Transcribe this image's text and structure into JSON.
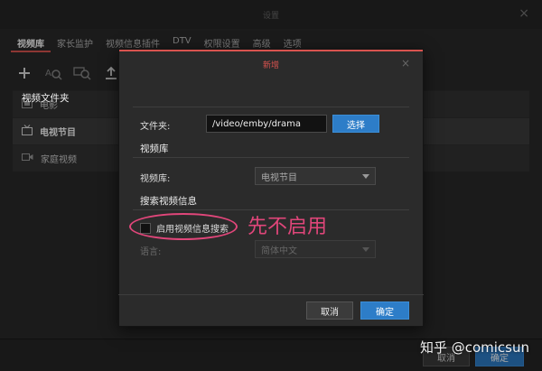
{
  "window": {
    "title": "设置",
    "close": "×"
  },
  "tabs": [
    {
      "label": "视频库",
      "active": true
    },
    {
      "label": "家长监护"
    },
    {
      "label": "视频信息插件"
    },
    {
      "label": "DTV"
    },
    {
      "label": "权限设置"
    },
    {
      "label": "高级"
    },
    {
      "label": "选项"
    }
  ],
  "toolbar": {
    "icons": [
      "add-icon",
      "metadata-search-icon",
      "subtitle-search-icon",
      "upload-icon"
    ]
  },
  "libraries": [
    {
      "label": "电影",
      "icon": "film-icon"
    },
    {
      "label": "电视节目",
      "icon": "tv-icon",
      "selected": true
    },
    {
      "label": "家庭视频",
      "icon": "video-camera-icon"
    }
  ],
  "outer_footer": {
    "cancel_label": "取消",
    "ok_label": "确定"
  },
  "dialog": {
    "title": "新增",
    "close": "×",
    "folder_section": "视频文件夹",
    "folder_label": "文件夹:",
    "folder_value": "/video/emby/drama",
    "browse_label": "选择",
    "library_section": "视频库",
    "library_label": "视频库:",
    "library_value": "电视节目",
    "search_section": "搜索视频信息",
    "enable_search_label": "启用视频信息搜索",
    "language_label": "语言:",
    "language_value": "简体中文",
    "cancel_label": "取消",
    "ok_label": "确定"
  },
  "annotation": {
    "text": "先不启用",
    "color": "#e0467a"
  },
  "watermark": "知乎 @comicsun",
  "colors": {
    "accent_red": "#d9534f",
    "primary_blue": "#2d7dc8"
  }
}
